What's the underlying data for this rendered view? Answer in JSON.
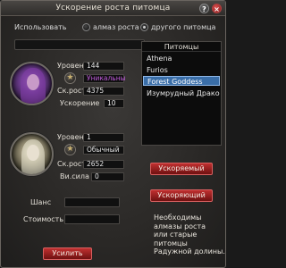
{
  "window": {
    "title": "Ускорение роста питомца",
    "help_label": "?",
    "close_label": "×"
  },
  "use_row": {
    "label": "Использовать",
    "option_1": "алмаз роста",
    "option_2": "другого питомца",
    "selected": "option_2"
  },
  "pet1": {
    "level_label": "Уровень",
    "level": "144",
    "quality": "Уникальны",
    "growth_label": "Ск.роста",
    "growth": "4375",
    "speedup_label": "Ускорение",
    "speedup": "10"
  },
  "pet2": {
    "level_label": "Уровень",
    "level": "1",
    "quality": "Обычный",
    "growth_label": "Ск.роста",
    "growth": "2652",
    "power_label": "Ви.сила",
    "power": "0"
  },
  "list": {
    "header": "Питомцы",
    "items": [
      "Athena",
      "Furios",
      "Forest Goddess",
      "Изумрудный Дракон"
    ],
    "selected_index": 2
  },
  "buttons": {
    "accelerated": "Ускоряемый",
    "accelerating": "Ускоряющий",
    "enhance": "Усилить"
  },
  "bottom": {
    "chance_label": "Шанс",
    "cost_label": "Стоимость"
  },
  "info_text": [
    "Необходимы",
    "алмазы роста",
    "или старые питомцы",
    "Радужной долины."
  ],
  "colors": {
    "accent_red": "#c03030",
    "selected_blue": "#3a6ea8",
    "quality_purple": "#c05adc"
  }
}
